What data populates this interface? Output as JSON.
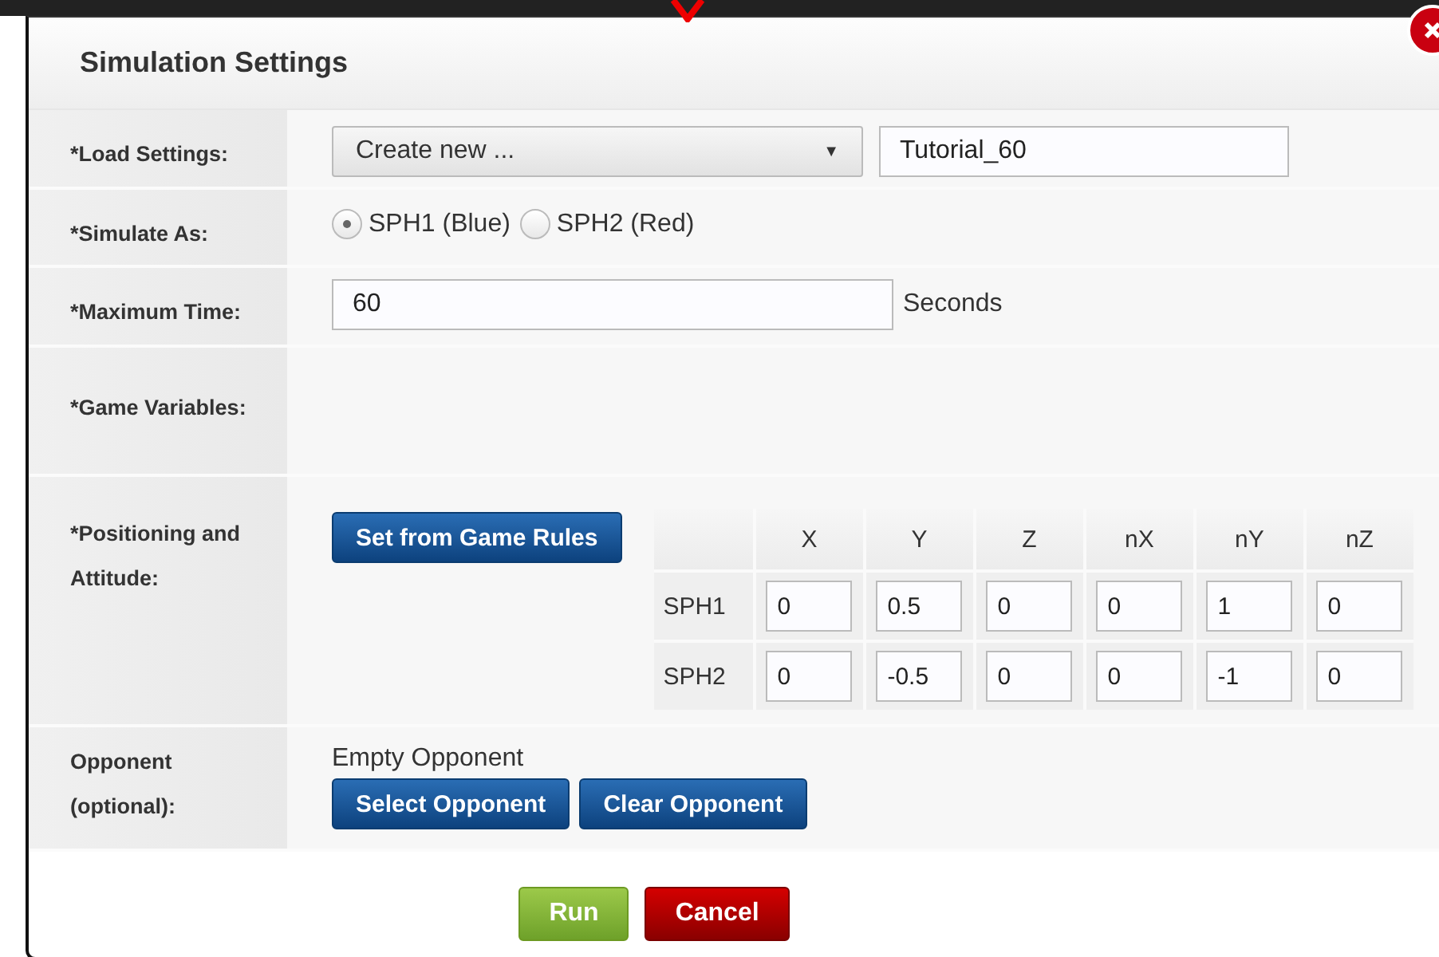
{
  "dialog": {
    "title": "Simulation Settings"
  },
  "load_settings": {
    "label": "*Load Settings:",
    "dropdown": "Create new ...",
    "caret": "▼",
    "name_value": "Tutorial_60"
  },
  "simulate_as": {
    "label": "*Simulate As:",
    "options": [
      {
        "label": "SPH1 (Blue)",
        "selected": true
      },
      {
        "label": "SPH2 (Red)",
        "selected": false
      }
    ]
  },
  "maximum_time": {
    "label": "*Maximum Time:",
    "value": "60",
    "unit": "Seconds"
  },
  "game_variables": {
    "label": "*Game Variables:"
  },
  "positioning": {
    "label_lines": [
      "*Positioning and",
      "Attitude:"
    ],
    "button": "Set from Game Rules",
    "columns": [
      "X",
      "Y",
      "Z",
      "nX",
      "nY",
      "nZ"
    ],
    "rows": [
      {
        "name": "SPH1",
        "values": [
          "0",
          "0.5",
          "0",
          "0",
          "1",
          "0"
        ]
      },
      {
        "name": "SPH2",
        "values": [
          "0",
          "-0.5",
          "0",
          "0",
          "-1",
          "0"
        ]
      }
    ]
  },
  "opponent": {
    "label_lines": [
      "Opponent",
      "(optional):"
    ],
    "current": "Empty Opponent",
    "buttons": [
      "Select Opponent",
      "Clear Opponent"
    ]
  },
  "footer_buttons": [
    {
      "label": "Run",
      "kind": "primary"
    },
    {
      "label": "Cancel",
      "kind": "danger"
    }
  ]
}
